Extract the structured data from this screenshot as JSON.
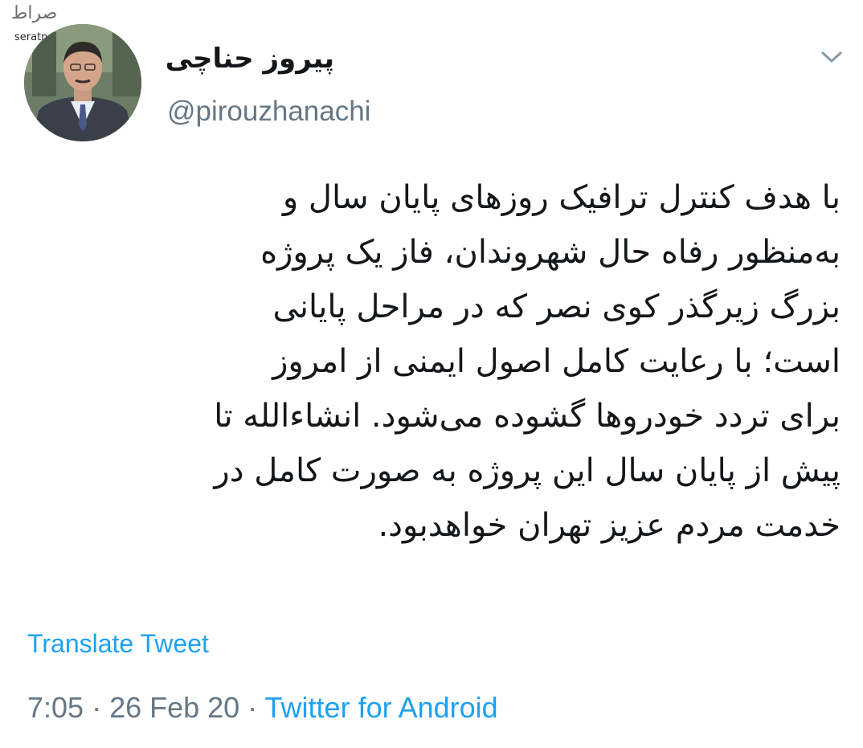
{
  "watermark": {
    "logo_text": "صراط",
    "site_text": "seratnews.ir"
  },
  "tweet": {
    "display_name": "پیروز حناچی",
    "handle": "@pirouzhanachi",
    "body_lines": [
      "با هدف کنترل ترافیک روزهای پایان سال و",
      "به‌منظور رفاه حال شهروندان، فاز یک پروژه",
      "بزرگ زیرگذر کوی نصر که در مراحل پایانی",
      "است؛ با رعایت کامل اصول ایمنی از امروز",
      "برای تردد خودروها گشوده می‌شود. انشاءالله تا",
      "پیش از پایان سال این پروژه به صورت کامل در",
      "خدمت مردم عزیز تهران خواهدبود."
    ],
    "translate_label": "Translate Tweet",
    "time": "7:05",
    "separator": " · ",
    "date": "26 Feb 20",
    "source": "Twitter for Android"
  },
  "icons": {
    "menu": "chevron-down-icon",
    "avatar": "profile-photo"
  },
  "colors": {
    "link": "#1da1f2",
    "secondary": "#657786",
    "text": "#14171a"
  }
}
